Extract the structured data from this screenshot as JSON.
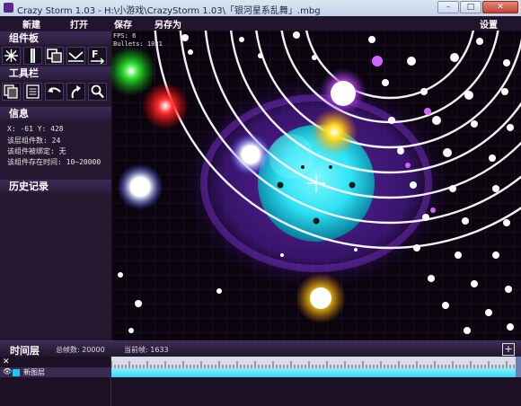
{
  "window": {
    "title": "Crazy Storm 1.03 - H:\\小游戏\\CrazyStorm 1.03\\「银河星系乱舞」.mbg",
    "min_symbol": "–",
    "max_symbol": "□",
    "close_symbol": "✕"
  },
  "menu": {
    "new": "新建",
    "open": "打开",
    "save": "保存",
    "save_as": "另存为",
    "settings": "设置"
  },
  "sidebar": {
    "components_title": "组件板",
    "tools_title": "工具栏",
    "info_title": "信息",
    "info": {
      "coords": "X: -61  Y: 428",
      "layer_count": "该层组件数: 24",
      "bound": "该组件被绑定: 无",
      "lifetime": "该组件存在时间: 10~20000"
    },
    "history_title": "历史记录"
  },
  "canvas": {
    "fps": "FPS: 6",
    "bullets": "Bullets: 1031"
  },
  "timeline": {
    "title": "时间层",
    "total_frames": "总帧数: 20000",
    "current_frame": "当前帧: 1633",
    "add_symbol": "+",
    "layers": [
      {
        "name": "新图层",
        "color": "#19c9f0"
      }
    ]
  },
  "colors": {
    "accent_cyan": "#19c9f0",
    "panel_bg": "#24172f",
    "header_bg": "#3d2a55"
  }
}
